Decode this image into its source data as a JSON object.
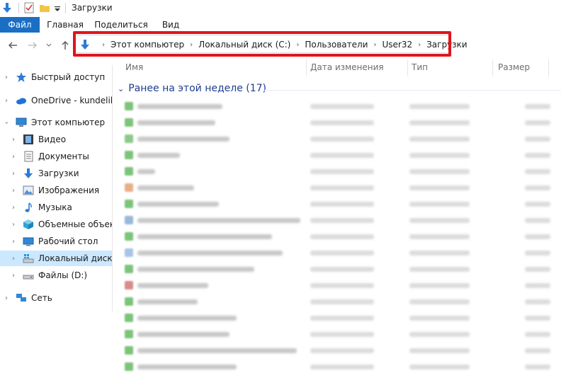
{
  "window": {
    "title": "Загрузки"
  },
  "ribbon": {
    "tabs": [
      "Файл",
      "Главная",
      "Поделиться",
      "Вид"
    ]
  },
  "address": {
    "crumbs": [
      "Этот компьютер",
      "Локальный диск (C:)",
      "Пользователи",
      "User32",
      "Загрузки"
    ]
  },
  "nav": {
    "items": [
      {
        "label": "Быстрый доступ",
        "icon": "star-icon"
      },
      {
        "label": "OneDrive - kundelik.k",
        "icon": "cloud-icon"
      },
      {
        "label": "Этот компьютер",
        "icon": "computer-icon"
      },
      {
        "label": "Видео",
        "icon": "video-icon"
      },
      {
        "label": "Документы",
        "icon": "documents-icon"
      },
      {
        "label": "Загрузки",
        "icon": "download-icon"
      },
      {
        "label": "Изображения",
        "icon": "pictures-icon"
      },
      {
        "label": "Музыка",
        "icon": "music-icon"
      },
      {
        "label": "Объемные объекты",
        "icon": "3d-objects-icon"
      },
      {
        "label": "Рабочий стол",
        "icon": "desktop-icon"
      },
      {
        "label": "Локальный диск (C:)",
        "icon": "drive-icon"
      },
      {
        "label": "Файлы (D:)",
        "icon": "drive-icon"
      },
      {
        "label": "Сеть",
        "icon": "network-icon"
      }
    ]
  },
  "columns": {
    "name": "Имя",
    "date": "Дата изменения",
    "type": "Тип",
    "size": "Размер"
  },
  "group": {
    "label": "Ранее на этой неделе (17)"
  },
  "colors": {
    "accent": "#1a6fc4",
    "highlight": "#e0141b",
    "group_text": "#1e3d8f",
    "selected_bg": "#cce8ff"
  }
}
